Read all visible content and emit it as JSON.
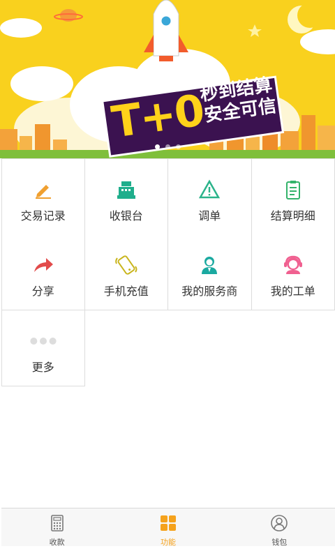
{
  "banner": {
    "big_text": "T+0",
    "slogan_line1": "秒到结算",
    "slogan_line2": "安全可信",
    "slides": [
      true,
      false,
      false
    ]
  },
  "functions": [
    {
      "label": "交易记录",
      "icon": "pencil-icon",
      "color": "#f0a030"
    },
    {
      "label": "收银台",
      "icon": "cash-register-icon",
      "color": "#1fae8c"
    },
    {
      "label": "调单",
      "icon": "warning-triangle-icon",
      "color": "#2bb38a"
    },
    {
      "label": "结算明细",
      "icon": "clipboard-icon",
      "color": "#33b36a"
    },
    {
      "label": "分享",
      "icon": "share-arrow-icon",
      "color": "#e24b4b"
    },
    {
      "label": "手机充值",
      "icon": "mobile-phone-icon",
      "color": "#c9b51d"
    },
    {
      "label": "我的服务商",
      "icon": "service-person-icon",
      "color": "#1aa9a0"
    },
    {
      "label": "我的工单",
      "icon": "headset-agent-icon",
      "color": "#f06090"
    },
    {
      "label": "更多",
      "icon": "more-dots-icon",
      "color": "#dddddd"
    }
  ],
  "tabbar": {
    "tabs": [
      {
        "label": "收款",
        "icon": "calculator-icon",
        "active": false
      },
      {
        "label": "功能",
        "icon": "grid-apps-icon",
        "active": true
      },
      {
        "label": "钱包",
        "icon": "user-circle-icon",
        "active": false
      }
    ],
    "active_color": "#f5a21c"
  }
}
